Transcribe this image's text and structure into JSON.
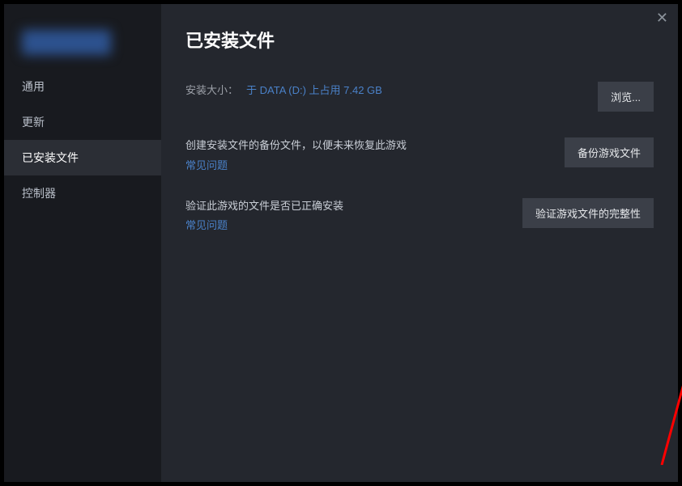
{
  "sidebar": {
    "items": [
      {
        "label": "通用"
      },
      {
        "label": "更新"
      },
      {
        "label": "已安装文件"
      },
      {
        "label": "控制器"
      }
    ],
    "activeIndex": 2
  },
  "main": {
    "title": "已安装文件",
    "sizeRow": {
      "label": "安装大小：",
      "value": "于 DATA (D:) 上占用 7.42 GB",
      "browseLabel": "浏览..."
    },
    "backupRow": {
      "desc": "创建安装文件的备份文件，以便未来恢复此游戏",
      "faq": "常见问题",
      "buttonLabel": "备份游戏文件"
    },
    "verifyRow": {
      "desc": "验证此游戏的文件是否已正确安装",
      "faq": "常见问题",
      "buttonLabel": "验证游戏文件的完整性"
    }
  },
  "close": "✕"
}
